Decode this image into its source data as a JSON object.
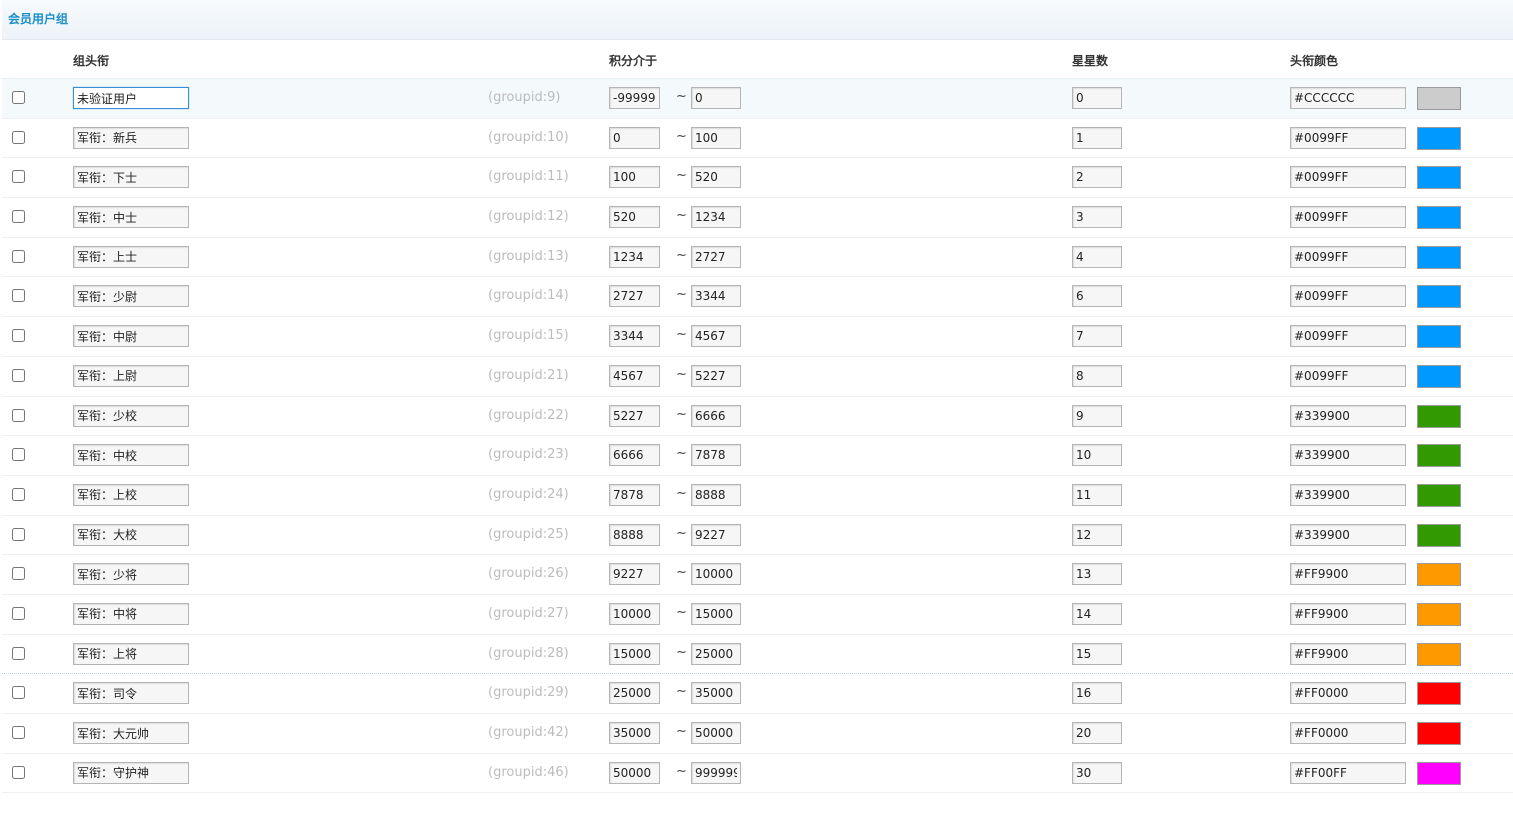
{
  "section": {
    "title": "会员用户组"
  },
  "columns": {
    "title": "组头衔",
    "points": "积分介于",
    "stars": "星星数",
    "color": "头衔颜色"
  },
  "tilde": "~",
  "rows": [
    {
      "name": "未验证用户",
      "gid": "(groupid:9)",
      "min": "-99999",
      "max": "0",
      "stars": "0",
      "color": "#CCCCCC"
    },
    {
      "name": "军衔：新兵",
      "gid": "(groupid:10)",
      "min": "0",
      "max": "100",
      "stars": "1",
      "color": "#0099FF"
    },
    {
      "name": "军衔：下士",
      "gid": "(groupid:11)",
      "min": "100",
      "max": "520",
      "stars": "2",
      "color": "#0099FF"
    },
    {
      "name": "军衔：中士",
      "gid": "(groupid:12)",
      "min": "520",
      "max": "1234",
      "stars": "3",
      "color": "#0099FF"
    },
    {
      "name": "军衔：上士",
      "gid": "(groupid:13)",
      "min": "1234",
      "max": "2727",
      "stars": "4",
      "color": "#0099FF"
    },
    {
      "name": "军衔：少尉",
      "gid": "(groupid:14)",
      "min": "2727",
      "max": "3344",
      "stars": "6",
      "color": "#0099FF"
    },
    {
      "name": "军衔：中尉",
      "gid": "(groupid:15)",
      "min": "3344",
      "max": "4567",
      "stars": "7",
      "color": "#0099FF"
    },
    {
      "name": "军衔：上尉",
      "gid": "(groupid:21)",
      "min": "4567",
      "max": "5227",
      "stars": "8",
      "color": "#0099FF"
    },
    {
      "name": "军衔：少校",
      "gid": "(groupid:22)",
      "min": "5227",
      "max": "6666",
      "stars": "9",
      "color": "#339900"
    },
    {
      "name": "军衔：中校",
      "gid": "(groupid:23)",
      "min": "6666",
      "max": "7878",
      "stars": "10",
      "color": "#339900"
    },
    {
      "name": "军衔：上校",
      "gid": "(groupid:24)",
      "min": "7878",
      "max": "8888",
      "stars": "11",
      "color": "#339900"
    },
    {
      "name": "军衔：大校",
      "gid": "(groupid:25)",
      "min": "8888",
      "max": "9227",
      "stars": "12",
      "color": "#339900"
    },
    {
      "name": "军衔：少将",
      "gid": "(groupid:26)",
      "min": "9227",
      "max": "10000",
      "stars": "13",
      "color": "#FF9900"
    },
    {
      "name": "军衔：中将",
      "gid": "(groupid:27)",
      "min": "10000",
      "max": "15000",
      "stars": "14",
      "color": "#FF9900"
    },
    {
      "name": "军衔：上将",
      "gid": "(groupid:28)",
      "min": "15000",
      "max": "25000",
      "stars": "15",
      "color": "#FF9900"
    },
    {
      "name": "军衔：司令",
      "gid": "(groupid:29)",
      "min": "25000",
      "max": "35000",
      "stars": "16",
      "color": "#FF0000"
    },
    {
      "name": "军衔：大元帅",
      "gid": "(groupid:42)",
      "min": "35000",
      "max": "50000",
      "stars": "20",
      "color": "#FF0000"
    },
    {
      "name": "军衔：守护神",
      "gid": "(groupid:46)",
      "min": "50000",
      "max": "999999",
      "stars": "30",
      "color": "#FF00FF"
    }
  ]
}
